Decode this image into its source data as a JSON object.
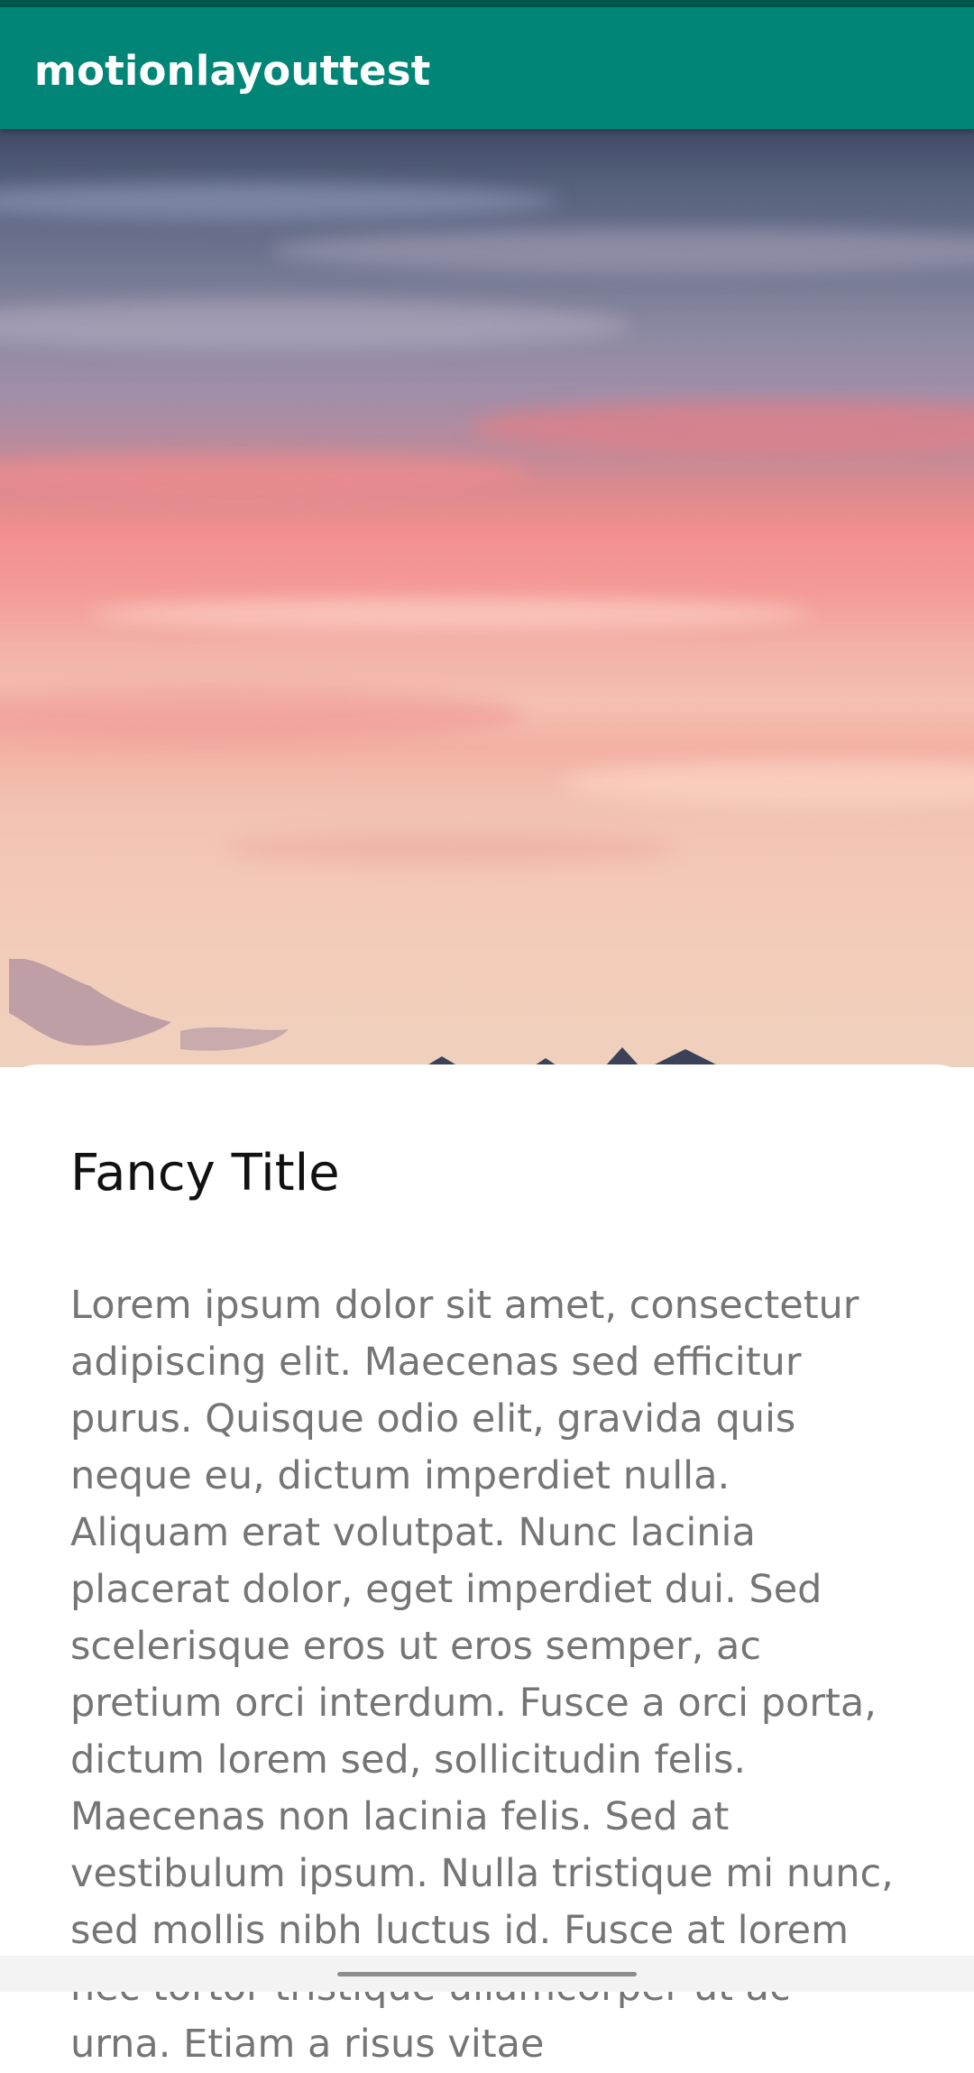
{
  "app": {
    "title": "motionlayouttest"
  },
  "colors": {
    "status_bar": "#00574B",
    "app_bar": "#008577",
    "title_text": "#111111",
    "body_text": "#757575"
  },
  "hero": {
    "description_icon": "sunset-sky-image"
  },
  "content": {
    "title": "Fancy Title",
    "body": "Lorem ipsum dolor sit amet, consectetur adipiscing elit. Maecenas sed efficitur purus. Quisque odio elit, gravida quis neque eu, dictum imperdiet nulla. Aliquam erat volutpat. Nunc lacinia placerat dolor, eget imperdiet dui. Sed scelerisque eros ut eros semper, ac pretium orci interdum. Fusce a orci porta, dictum lorem sed, sollicitudin felis. Maecenas non lacinia felis. Sed at vestibulum ipsum. Nulla tristique mi nunc, sed mollis nibh luctus id. Fusce at lorem nec tortor tristique ullamcorper ut ac urna. Etiam a risus vitae"
  },
  "navigation": {
    "handle_icon": "gesture-handle-icon"
  }
}
